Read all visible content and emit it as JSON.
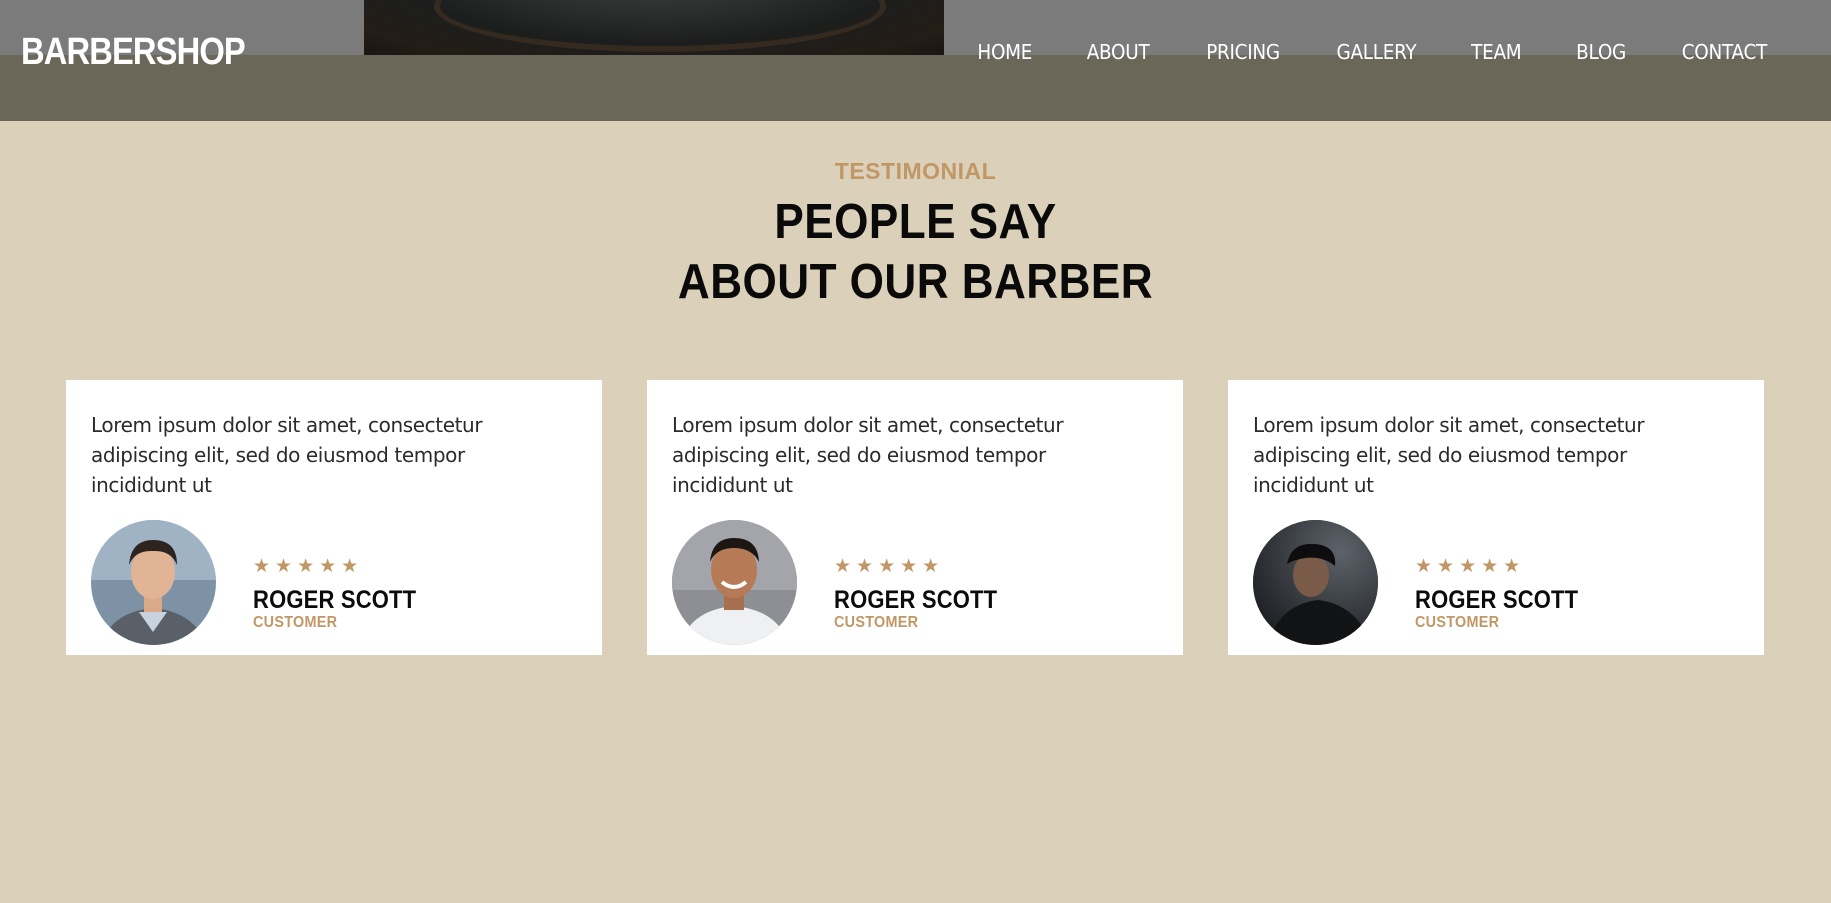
{
  "header": {
    "brand": "BARBERSHOP",
    "nav": [
      "HOME",
      "ABOUT",
      "PRICING",
      "GALLERY",
      "TEAM",
      "BLOG",
      "CONTACT"
    ]
  },
  "section": {
    "eyebrow": "TESTIMONIAL",
    "title_line1": "PEOPLE SAY",
    "title_line2": "ABOUT OUR BARBER"
  },
  "testimonials": [
    {
      "quote": "Lorem ipsum dolor sit amet, consectetur adipiscing elit, sed do eiusmod tempor incididunt ut",
      "rating": 5,
      "stars": "★★★★★",
      "name": "ROGER SCOTT",
      "role": "CUSTOMER"
    },
    {
      "quote": "Lorem ipsum dolor sit amet, consectetur adipiscing elit, sed do eiusmod tempor incididunt ut",
      "rating": 5,
      "stars": "★★★★★",
      "name": "ROGER SCOTT",
      "role": "CUSTOMER"
    },
    {
      "quote": "Lorem ipsum dolor sit amet, consectetur adipiscing elit, sed do eiusmod tempor incididunt ut",
      "rating": 5,
      "stars": "★★★★★",
      "name": "ROGER SCOTT",
      "role": "CUSTOMER"
    }
  ],
  "colors": {
    "page_background": "#dbd1ba",
    "header_background": "#6a6759",
    "accent": "#c29766",
    "card_background": "#ffffff",
    "heading": "#0a0a0a"
  }
}
